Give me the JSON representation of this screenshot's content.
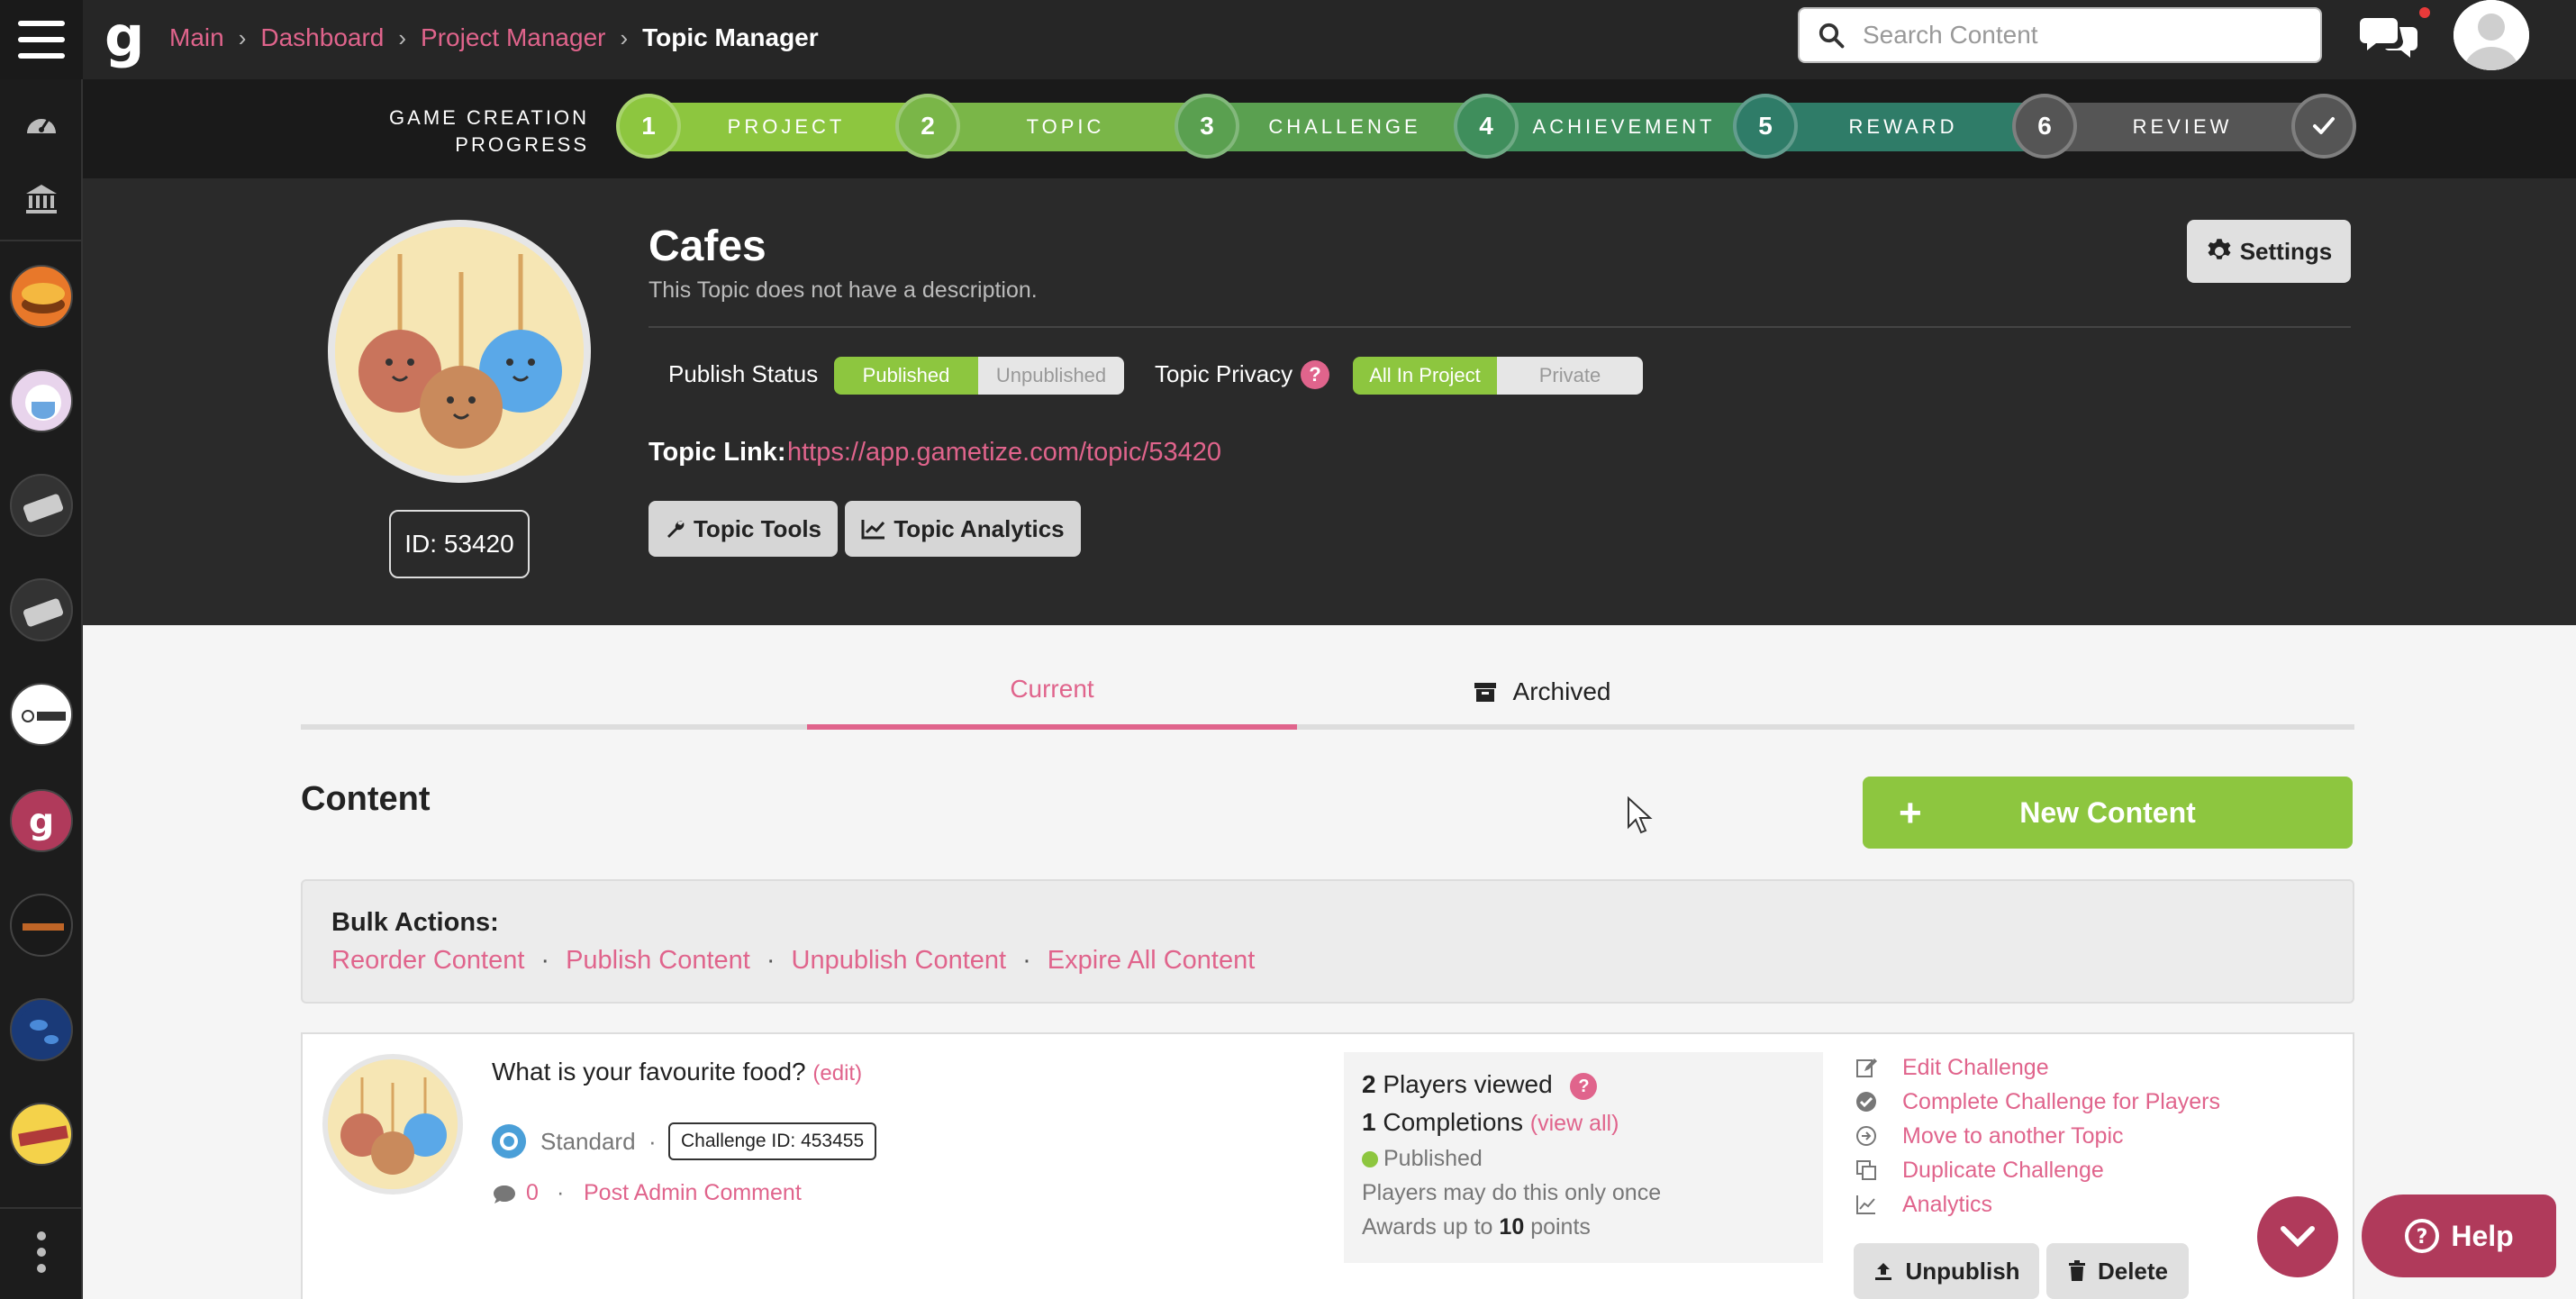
{
  "header": {
    "breadcrumb": [
      {
        "label": "Main"
      },
      {
        "label": "Dashboard"
      },
      {
        "label": "Project Manager"
      }
    ],
    "current_page": "Topic Manager",
    "search": {
      "placeholder": "Search Content",
      "value": ""
    }
  },
  "progress": {
    "label_line1": "GAME CREATION",
    "label_line2": "PROGRESS",
    "steps": [
      {
        "num": "1",
        "label": "PROJECT",
        "color": "#8dc63f"
      },
      {
        "num": "2",
        "label": "TOPIC",
        "color": "#7ab648"
      },
      {
        "num": "3",
        "label": "CHALLENGE",
        "color": "#5aa050"
      },
      {
        "num": "4",
        "label": "ACHIEVEMENT",
        "color": "#3f8e5c"
      },
      {
        "num": "5",
        "label": "REWARD",
        "color": "#2f7c68"
      },
      {
        "num": "6",
        "label": "REVIEW",
        "color": "#555555"
      }
    ]
  },
  "topic": {
    "title": "Cafes",
    "description": "This Topic does not have a description.",
    "id_label": "ID: 53420",
    "settings_label": "Settings",
    "publish_status_label": "Publish Status",
    "publish_options": {
      "on": "Published",
      "off": "Unpublished"
    },
    "privacy_label": "Topic Privacy",
    "privacy_options": {
      "on": "All In Project",
      "off": "Private"
    },
    "link_label": "Topic Link:",
    "link_url": "https://app.gametize.com/topic/53420",
    "tools_label": "Topic Tools",
    "analytics_label": "Topic Analytics"
  },
  "tabs": {
    "current": "Current",
    "archived": "Archived"
  },
  "content": {
    "heading": "Content",
    "new_content_label": "New Content",
    "bulk_title": "Bulk Actions:",
    "bulk_links": [
      "Reorder Content",
      "Publish Content",
      "Unpublish Content",
      "Expire All Content"
    ]
  },
  "challenge": {
    "title": "What is your favourite food?",
    "edit_label": "(edit)",
    "type": "Standard",
    "id_label": "Challenge ID: 453455",
    "comment_count": "0",
    "post_comment": "Post Admin Comment",
    "players_viewed_num": "2",
    "players_viewed_label": "Players viewed",
    "completions_num": "1",
    "completions_label": "Completions",
    "view_all": "(view all)",
    "status": "Published",
    "repeat_note": "Players may do this only once",
    "awards_prefix": "Awards up to",
    "awards_points": "10",
    "awards_suffix": "points",
    "actions": [
      "Edit Challenge",
      "Complete Challenge for Players",
      "Move to another Topic",
      "Duplicate Challenge",
      "Analytics"
    ],
    "unpublish_label": "Unpublish",
    "delete_label": "Delete"
  },
  "help_label": "Help",
  "colors": {
    "accent_pink": "#e0648c",
    "green": "#8dc63f",
    "help_bg": "#b03a5b"
  }
}
